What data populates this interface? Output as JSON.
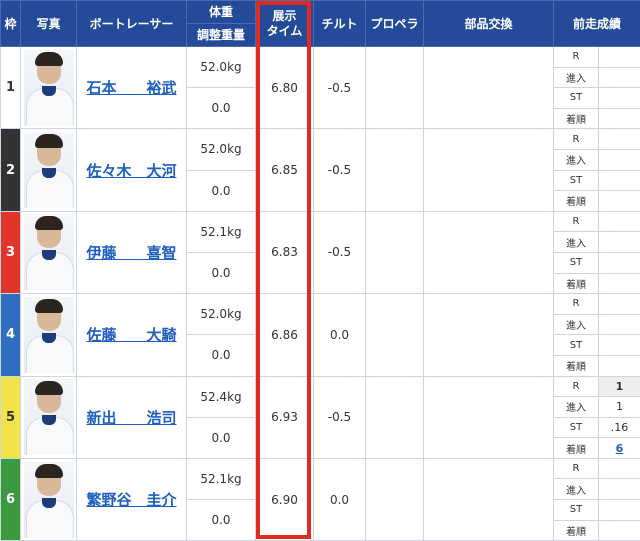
{
  "headers": {
    "frame": "枠",
    "photo": "写真",
    "racer": "ボートレーサー",
    "weight": "体重",
    "adjust": "調整重量",
    "tenji_line1": "展示",
    "tenji_line2": "タイム",
    "tilt": "チルト",
    "propeller": "プロペラ",
    "parts": "部品交換",
    "prev": "前走成績"
  },
  "result_labels": [
    "R",
    "進入",
    "ST",
    "着順"
  ],
  "colors": {
    "frame1": "#ffffff",
    "frame2": "#333333",
    "frame3": "#e0352b",
    "frame4": "#2f6fc2",
    "frame5": "#f2e34a",
    "frame6": "#3a9a3f",
    "highlight": "#e02a1f",
    "header": "#244b9a"
  },
  "racers": [
    {
      "frame": "1",
      "name": "石本　　裕武",
      "weight": "52.0kg",
      "adjust": "0.0",
      "tenji": "6.80",
      "tilt": "-0.5",
      "r": "",
      "entry": "",
      "st": "",
      "finish": ""
    },
    {
      "frame": "2",
      "name": "佐々木　大河",
      "weight": "52.0kg",
      "adjust": "0.0",
      "tenji": "6.85",
      "tilt": "-0.5",
      "r": "",
      "entry": "",
      "st": "",
      "finish": ""
    },
    {
      "frame": "3",
      "name": "伊藤　　喜智",
      "weight": "52.1kg",
      "adjust": "0.0",
      "tenji": "6.83",
      "tilt": "-0.5",
      "r": "",
      "entry": "",
      "st": "",
      "finish": ""
    },
    {
      "frame": "4",
      "name": "佐藤　　大騎",
      "weight": "52.0kg",
      "adjust": "0.0",
      "tenji": "6.86",
      "tilt": "0.0",
      "r": "",
      "entry": "",
      "st": "",
      "finish": ""
    },
    {
      "frame": "5",
      "name": "新出　　浩司",
      "weight": "52.4kg",
      "adjust": "0.0",
      "tenji": "6.93",
      "tilt": "-0.5",
      "r": "1",
      "entry": "1",
      "st": ".16",
      "finish": "6"
    },
    {
      "frame": "6",
      "name": "繁野谷　圭介",
      "weight": "52.1kg",
      "adjust": "0.0",
      "tenji": "6.90",
      "tilt": "0.0",
      "r": "",
      "entry": "",
      "st": "",
      "finish": ""
    }
  ]
}
